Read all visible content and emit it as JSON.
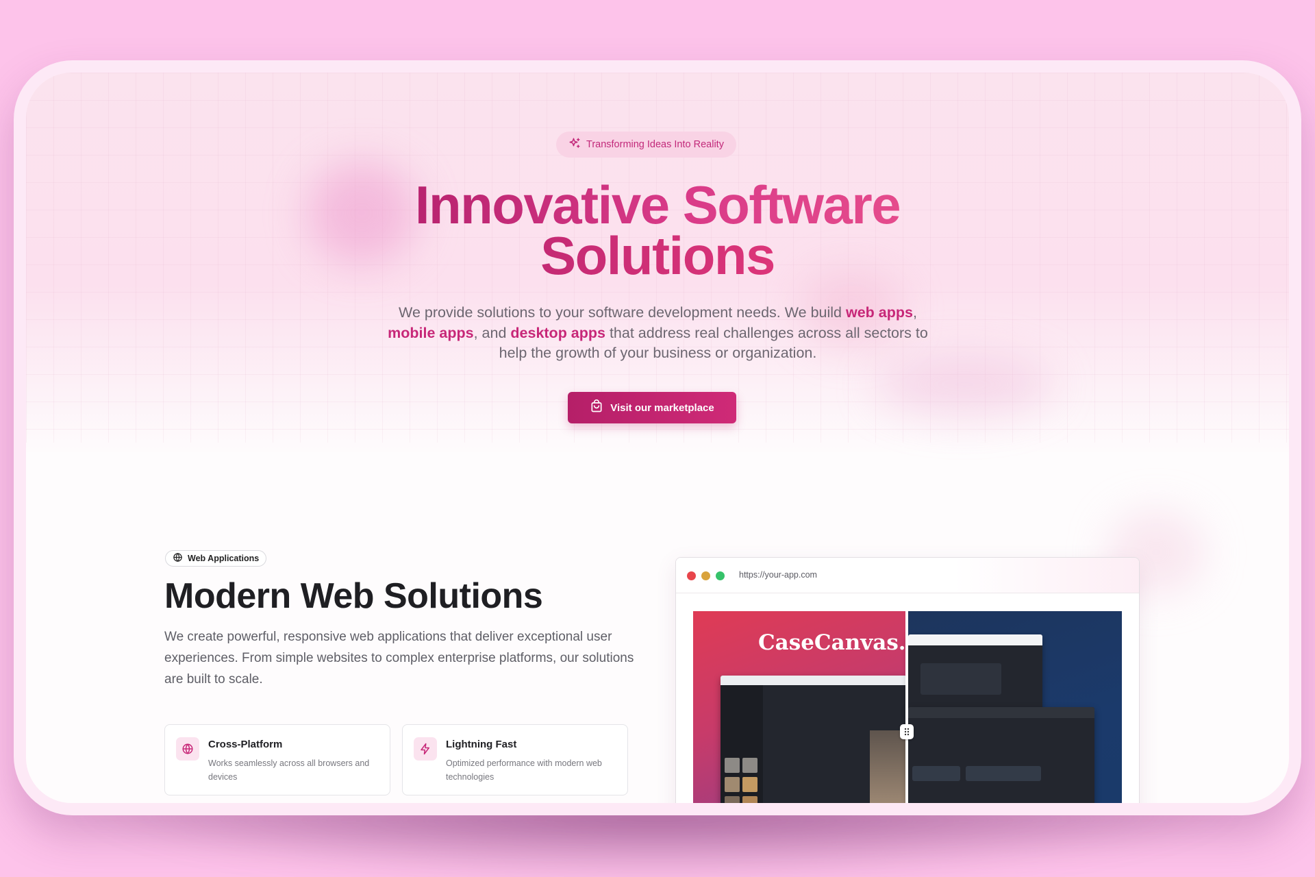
{
  "hero": {
    "badge": "Transforming Ideas Into Reality",
    "title_line1": "Innovative Software",
    "title_line2": "Solutions",
    "desc_part1": "We provide solutions to your software development needs. We build ",
    "desc_hl1": "web apps",
    "desc_part2": ",",
    "desc_hl2": "mobile apps",
    "desc_part3": ", and ",
    "desc_hl3": "desktop apps",
    "desc_part4": " that address real challenges across all sectors to help the growth of your business or organization.",
    "cta_label": "Visit our marketplace"
  },
  "web_section": {
    "chip_label": "Web Applications",
    "title": "Modern Web Solutions",
    "description": "We create powerful, responsive web applications that deliver exceptional user experiences. From simple websites to complex enterprise platforms, our solutions are built to scale.",
    "features": [
      {
        "title": "Cross-Platform",
        "description": "Works seamlessly across all browsers and devices",
        "icon": "globe-icon"
      },
      {
        "title": "Lightning Fast",
        "description": "Optimized performance with modern web technologies",
        "icon": "zap-icon"
      }
    ]
  },
  "browser_mock": {
    "url": "https://your-app.com",
    "preview_title": "CaseCanvas. Pl"
  },
  "colors": {
    "page_bg": "#fdc3ea",
    "accent": "#c72778",
    "cta_bg": "#b51f68",
    "heading": "#1f1f23"
  }
}
